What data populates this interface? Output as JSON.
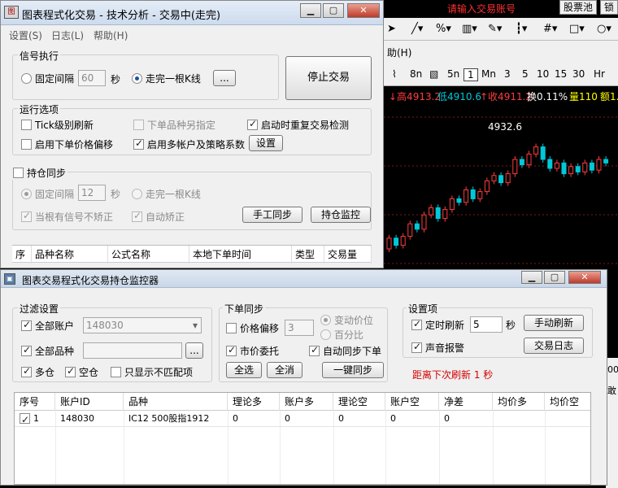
{
  "background_app": {
    "notice": "请输入交易账号",
    "stock_pool_button": "股票池",
    "lock_button": "锁",
    "toolbar_icons": [
      "cursor-icon",
      "line-icon",
      "percent-icon",
      "ruler-icon",
      "pen-icon",
      "bars-icon",
      "grid-icon",
      "rect-icon",
      "circle-icon"
    ],
    "menu_help": "助(H)",
    "periods": [
      "8n",
      "5n",
      "1",
      "Mn",
      "3",
      "5",
      "10",
      "15",
      "30",
      "Hr"
    ],
    "quote": {
      "high": "↓高4913.2",
      "low": "低4910.6",
      "close": "↑收4911.2",
      "turnover": "换0.11%",
      "volume": "量110",
      "amount": "额1.1"
    },
    "chart_peak_label": "4932.6",
    "side_label_1": "00",
    "side_label_2": "敢",
    "colors": {
      "up": "#ff3c3c",
      "down": "#00c8d8",
      "bg": "#000000"
    }
  },
  "main_window": {
    "title": "图表程式化交易 - 技术分析 - 交易中(走完)",
    "icon_text": "图",
    "menu": [
      "设置(S)",
      "日志(L)",
      "帮助(H)"
    ],
    "signal_group": {
      "title": "信号执行",
      "fixed_interval_label": "固定间隔",
      "interval_value": "60",
      "seconds_unit": "秒",
      "bar_close_label": "走完一根K线",
      "ellipsis_button": "...",
      "stop_button": "停止交易"
    },
    "run_group": {
      "title": "运行选项",
      "tick_refresh": "Tick级别刷新",
      "order_other_symbol": "下单品种另指定",
      "startup_recheck": "启动时重复交易检测",
      "price_offset": "启用下单价格偏移",
      "multi_account": "启用多帐户及策略系数",
      "settings_button": "设置"
    },
    "position_group": {
      "title": "持仓同步",
      "fixed_interval_label": "固定间隔",
      "interval_value": "12",
      "seconds_unit": "秒",
      "bar_close_label": "走完一根K线",
      "no_correct_label": "当根有信号不矫正",
      "auto_correct_label": "自动矫正",
      "manual_sync_button": "手工同步",
      "position_monitor_button": "持仓监控"
    },
    "table_headers": [
      "序",
      "品种名称",
      "公式名称",
      "本地下单时间",
      "类型",
      "交易量"
    ]
  },
  "monitor_window": {
    "title": "图表交易程式化交易持仓监控器",
    "filter_group": {
      "title": "过滤设置",
      "all_accounts": "全部账户",
      "account_value": "148030",
      "all_symbols": "全部品种",
      "symbol_value": "",
      "ellipsis_button": "...",
      "long_label": "多仓",
      "short_label": "空仓",
      "mismatch_only": "只显示不匹配项"
    },
    "order_group": {
      "title": "下单同步",
      "price_offset": "价格偏移",
      "offset_value": "3",
      "tick_price": "变动价位",
      "percent": "百分比",
      "market_order": "市价委托",
      "auto_sync": "自动同步下单",
      "select_all": "全选",
      "deselect_all": "全消",
      "one_click_sync": "一键同步"
    },
    "settings_group": {
      "title": "设置项",
      "timed_refresh": "定时刷新",
      "refresh_value": "5",
      "seconds_unit": "秒",
      "manual_refresh": "手动刷新",
      "sound_alert": "声音报警",
      "trade_log": "交易日志",
      "countdown": "距离下次刷新 1 秒"
    },
    "table": {
      "headers": [
        "序号",
        "账户ID",
        "品种",
        "理论多",
        "账户多",
        "理论空",
        "账户空",
        "净差",
        "均价多",
        "均价空"
      ],
      "rows": [
        [
          "1",
          "148030",
          "IC12 500股指1912",
          "0",
          "0",
          "0",
          "0",
          "0",
          "",
          ""
        ]
      ]
    }
  }
}
